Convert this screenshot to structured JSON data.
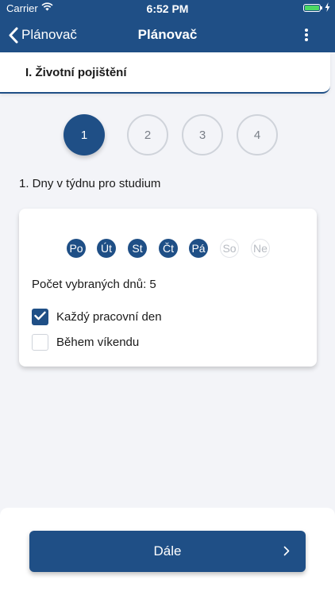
{
  "status": {
    "carrier": "Carrier",
    "time": "6:52 PM"
  },
  "nav": {
    "back_label": "Plánovač",
    "title": "Plánovač"
  },
  "section": {
    "title": "I. Životní pojištění"
  },
  "steps": [
    {
      "label": "1",
      "active": true
    },
    {
      "label": "2",
      "active": false
    },
    {
      "label": "3",
      "active": false
    },
    {
      "label": "4",
      "active": false
    }
  ],
  "question": "1. Dny v týdnu pro studium",
  "days": [
    {
      "label": "Po",
      "selected": true
    },
    {
      "label": "Út",
      "selected": true
    },
    {
      "label": "St",
      "selected": true
    },
    {
      "label": "Čt",
      "selected": true
    },
    {
      "label": "Pá",
      "selected": true
    },
    {
      "label": "So",
      "selected": false
    },
    {
      "label": "Ne",
      "selected": false
    }
  ],
  "selected_count_label": "Počet vybraných dnů: 5",
  "options": [
    {
      "label": "Každý pracovní den",
      "checked": true
    },
    {
      "label": "Během víkendu",
      "checked": false
    }
  ],
  "next_button": {
    "label": "Dále"
  },
  "colors": {
    "primary": "#1f4f86",
    "battery": "#4cd964"
  }
}
